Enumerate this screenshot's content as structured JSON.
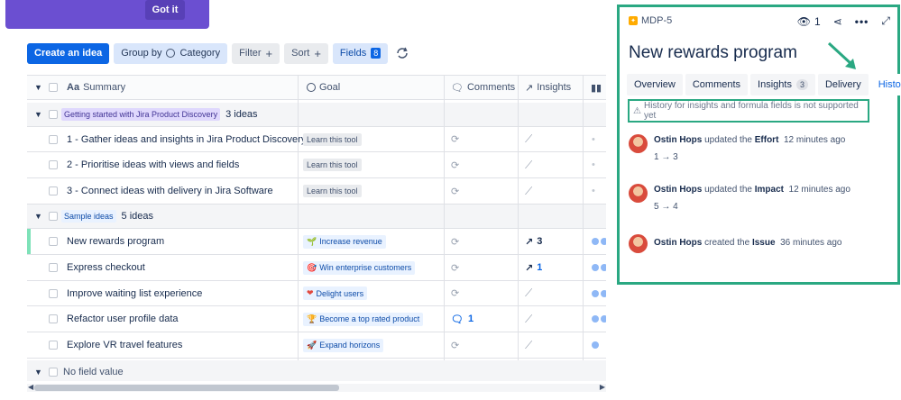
{
  "banner": {
    "got_it": "Got it"
  },
  "toolbar": {
    "create": "Create an idea",
    "group_by": "Group by",
    "group_value": "Category",
    "filter": "Filter",
    "sort": "Sort",
    "fields": "Fields",
    "fields_count": "8"
  },
  "table": {
    "headers": {
      "summary": "Summary",
      "goal": "Goal",
      "comments": "Comments",
      "insights": "Insights"
    },
    "groups": [
      {
        "label": "Getting started with Jira Product Discovery",
        "count": "3 ideas"
      },
      {
        "label": "Sample ideas",
        "count": "5 ideas"
      },
      {
        "label": "No field value"
      }
    ],
    "rows": [
      {
        "summary": "1 - Gather ideas and insights in Jira Product Discovery",
        "goal": "Learn this tool"
      },
      {
        "summary": "2 - Prioritise ideas with views and fields",
        "goal": "Learn this tool"
      },
      {
        "summary": "3 - Connect ideas with delivery in Jira Software",
        "goal": "Learn this tool"
      },
      {
        "summary": "New rewards program",
        "goal": "Increase revenue",
        "goal_icon": "🌱",
        "insights": "3"
      },
      {
        "summary": "Express checkout",
        "goal": "Win enterprise customers",
        "goal_icon": "🎯",
        "insights": "1"
      },
      {
        "summary": "Improve waiting list experience",
        "goal": "Delight users",
        "goal_icon": "❤"
      },
      {
        "summary": "Refactor user profile data",
        "goal": "Become a top rated product",
        "goal_icon": "🏆",
        "comments": "1"
      },
      {
        "summary": "Explore VR travel features",
        "goal": "Expand horizons",
        "goal_icon": "🚀"
      }
    ]
  },
  "panel": {
    "key": "MDP-5",
    "watchers": "1",
    "title": "New rewards program",
    "tabs": {
      "overview": "Overview",
      "comments": "Comments",
      "insights": "Insights",
      "insights_count": "3",
      "delivery": "Delivery",
      "history": "History"
    },
    "warning": "History for insights and formula fields is not supported yet",
    "history": [
      {
        "user": "Ostin Hops",
        "action": "updated the",
        "field": "Effort",
        "time": "12 minutes ago",
        "change": "1 → 3"
      },
      {
        "user": "Ostin Hops",
        "action": "updated the",
        "field": "Impact",
        "time": "12 minutes ago",
        "change": "5 → 4"
      },
      {
        "user": "Ostin Hops",
        "action": "created the",
        "field": "Issue",
        "time": "36 minutes ago"
      }
    ]
  },
  "colors": {
    "accent": "#0c66e4",
    "highlight": "#2aa882",
    "banner": "#6b4fd1"
  }
}
